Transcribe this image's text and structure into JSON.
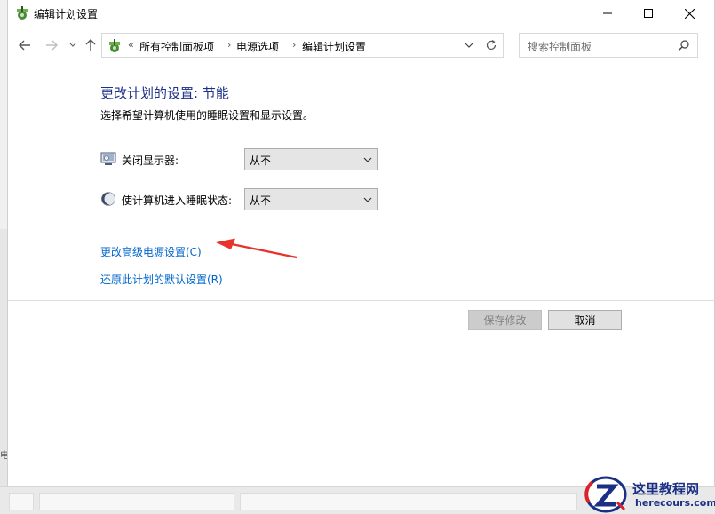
{
  "window": {
    "title": "编辑计划设置",
    "controls": {
      "minimize": "minimize-icon",
      "maximize": "maximize-icon",
      "close": "close-icon"
    }
  },
  "nav": {
    "breadcrumbs": [
      "所有控制面板项",
      "电源选项",
      "编辑计划设置"
    ],
    "overflow": "«",
    "search_placeholder": "搜索控制面板"
  },
  "content": {
    "heading": "更改计划的设置: 节能",
    "subheading": "选择希望计算机使用的睡眠设置和显示设置。",
    "settings": [
      {
        "label": "关闭显示器:",
        "value": "从不",
        "icon": "monitor-icon"
      },
      {
        "label": "使计算机进入睡眠状态:",
        "value": "从不",
        "icon": "sleep-moon-icon"
      }
    ],
    "links": {
      "advanced": "更改高级电源设置(C)",
      "restore": "还原此计划的默认设置(R)"
    },
    "buttons": {
      "save": "保存修改",
      "cancel": "取消"
    }
  },
  "background": {
    "left_text": "电"
  },
  "watermark": {
    "title": "这里教程网",
    "url": "herecours.com"
  },
  "colors": {
    "heading": "#1e3287",
    "link": "#0066cc",
    "arrow": "#e8322b"
  }
}
